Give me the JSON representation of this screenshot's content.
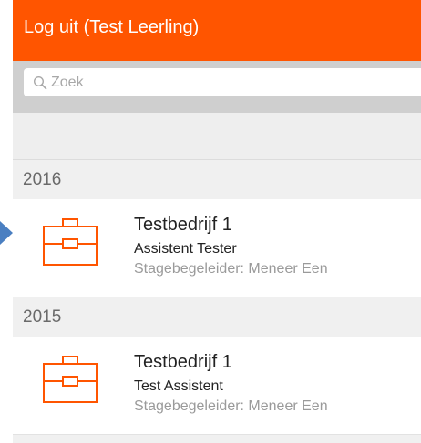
{
  "header": {
    "title": "Log uit (Test Leerling)",
    "color": "#ff5500"
  },
  "search": {
    "placeholder": "Zoek"
  },
  "sections": [
    {
      "year": "2016",
      "items": [
        {
          "company": "Testbedrijf 1",
          "role": "Assistent Tester",
          "supervisor": "Stagebegeleider: Meneer Een",
          "icon": "briefcase-icon"
        }
      ]
    },
    {
      "year": "2015",
      "items": [
        {
          "company": "Testbedrijf 1",
          "role": "Test Assistent",
          "supervisor": "Stagebegeleider: Meneer Een",
          "icon": "briefcase-icon"
        }
      ]
    }
  ],
  "accent_color": "#ff5500",
  "annotation_arrow_color": "#4a7fc1"
}
